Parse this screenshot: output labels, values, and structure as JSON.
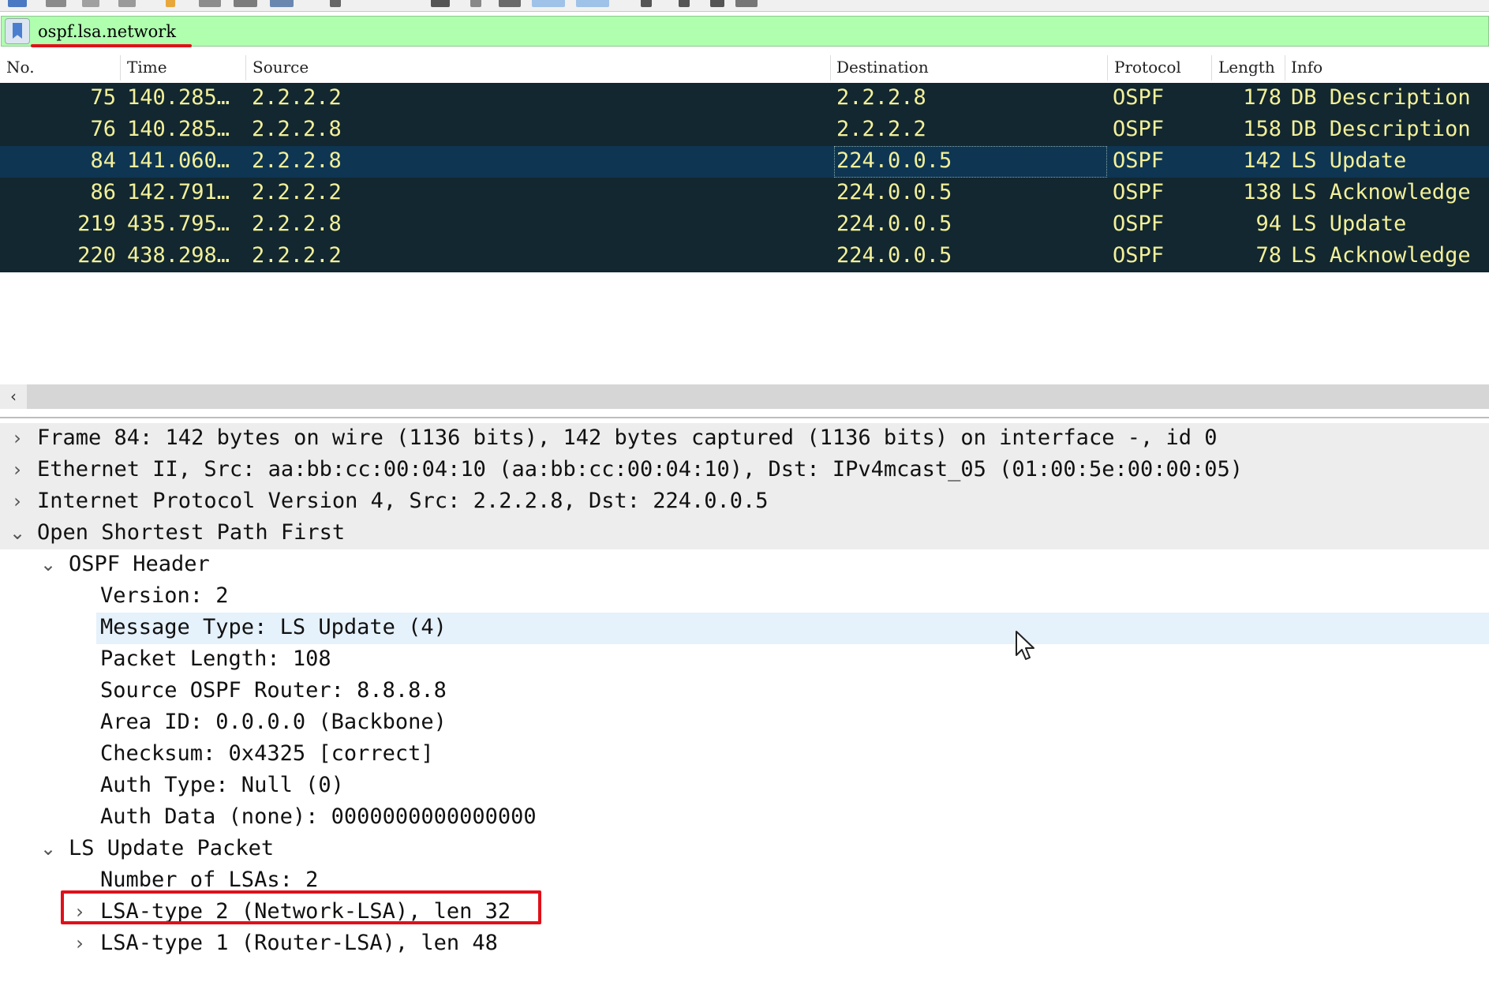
{
  "filter": {
    "value": "ospf.lsa.network"
  },
  "columns": {
    "no": "No.",
    "time": "Time",
    "source": "Source",
    "destination": "Destination",
    "protocol": "Protocol",
    "length": "Length",
    "info": "Info"
  },
  "packets": [
    {
      "no": "75",
      "time": "140.285…",
      "source": "2.2.2.2",
      "destination": "2.2.2.8",
      "protocol": "OSPF",
      "length": "178",
      "info": "DB Description"
    },
    {
      "no": "76",
      "time": "140.285…",
      "source": "2.2.2.8",
      "destination": "2.2.2.2",
      "protocol": "OSPF",
      "length": "158",
      "info": "DB Description"
    },
    {
      "no": "84",
      "time": "141.060…",
      "source": "2.2.2.8",
      "destination": "224.0.0.5",
      "protocol": "OSPF",
      "length": "142",
      "info": "LS Update"
    },
    {
      "no": "86",
      "time": "142.791…",
      "source": "2.2.2.2",
      "destination": "224.0.0.5",
      "protocol": "OSPF",
      "length": "138",
      "info": "LS Acknowledge"
    },
    {
      "no": "219",
      "time": "435.795…",
      "source": "2.2.2.8",
      "destination": "224.0.0.5",
      "protocol": "OSPF",
      "length": "94",
      "info": "LS Update"
    },
    {
      "no": "220",
      "time": "438.298…",
      "source": "2.2.2.2",
      "destination": "224.0.0.5",
      "protocol": "OSPF",
      "length": "78",
      "info": "LS Acknowledge"
    }
  ],
  "details": [
    "Frame 84: 142 bytes on wire (1136 bits), 142 bytes captured (1136 bits) on interface -, id 0",
    "Ethernet II, Src: aa:bb:cc:00:04:10 (aa:bb:cc:00:04:10), Dst: IPv4mcast_05 (01:00:5e:00:00:05)",
    "Internet Protocol Version 4, Src: 2.2.2.8, Dst: 224.0.0.5",
    "Open Shortest Path First",
    "OSPF Header",
    "Version: 2",
    "Message Type: LS Update (4)",
    "Packet Length: 108",
    "Source OSPF Router: 8.8.8.8",
    "Area ID: 0.0.0.0 (Backbone)",
    "Checksum: 0x4325 [correct]",
    "Auth Type: Null (0)",
    "Auth Data (none): 0000000000000000",
    "LS Update Packet",
    "Number of LSAs: 2",
    "LSA-type 2 (Network-LSA), len 32",
    "LSA-type 1 (Router-LSA), len 48"
  ],
  "icons": {
    "collapsed": "chevron-right-icon",
    "expanded": "chevron-down-icon",
    "bookmark": "bookmark-icon",
    "scroll_left": "chevron-left-icon"
  },
  "colors": {
    "filter_valid_bg": "#afffaf",
    "packet_row_bg": "#12272f",
    "packet_row_text": "#f3f09a",
    "selected_row_bg": "#0e3552",
    "annotation_red": "#e0101a"
  }
}
